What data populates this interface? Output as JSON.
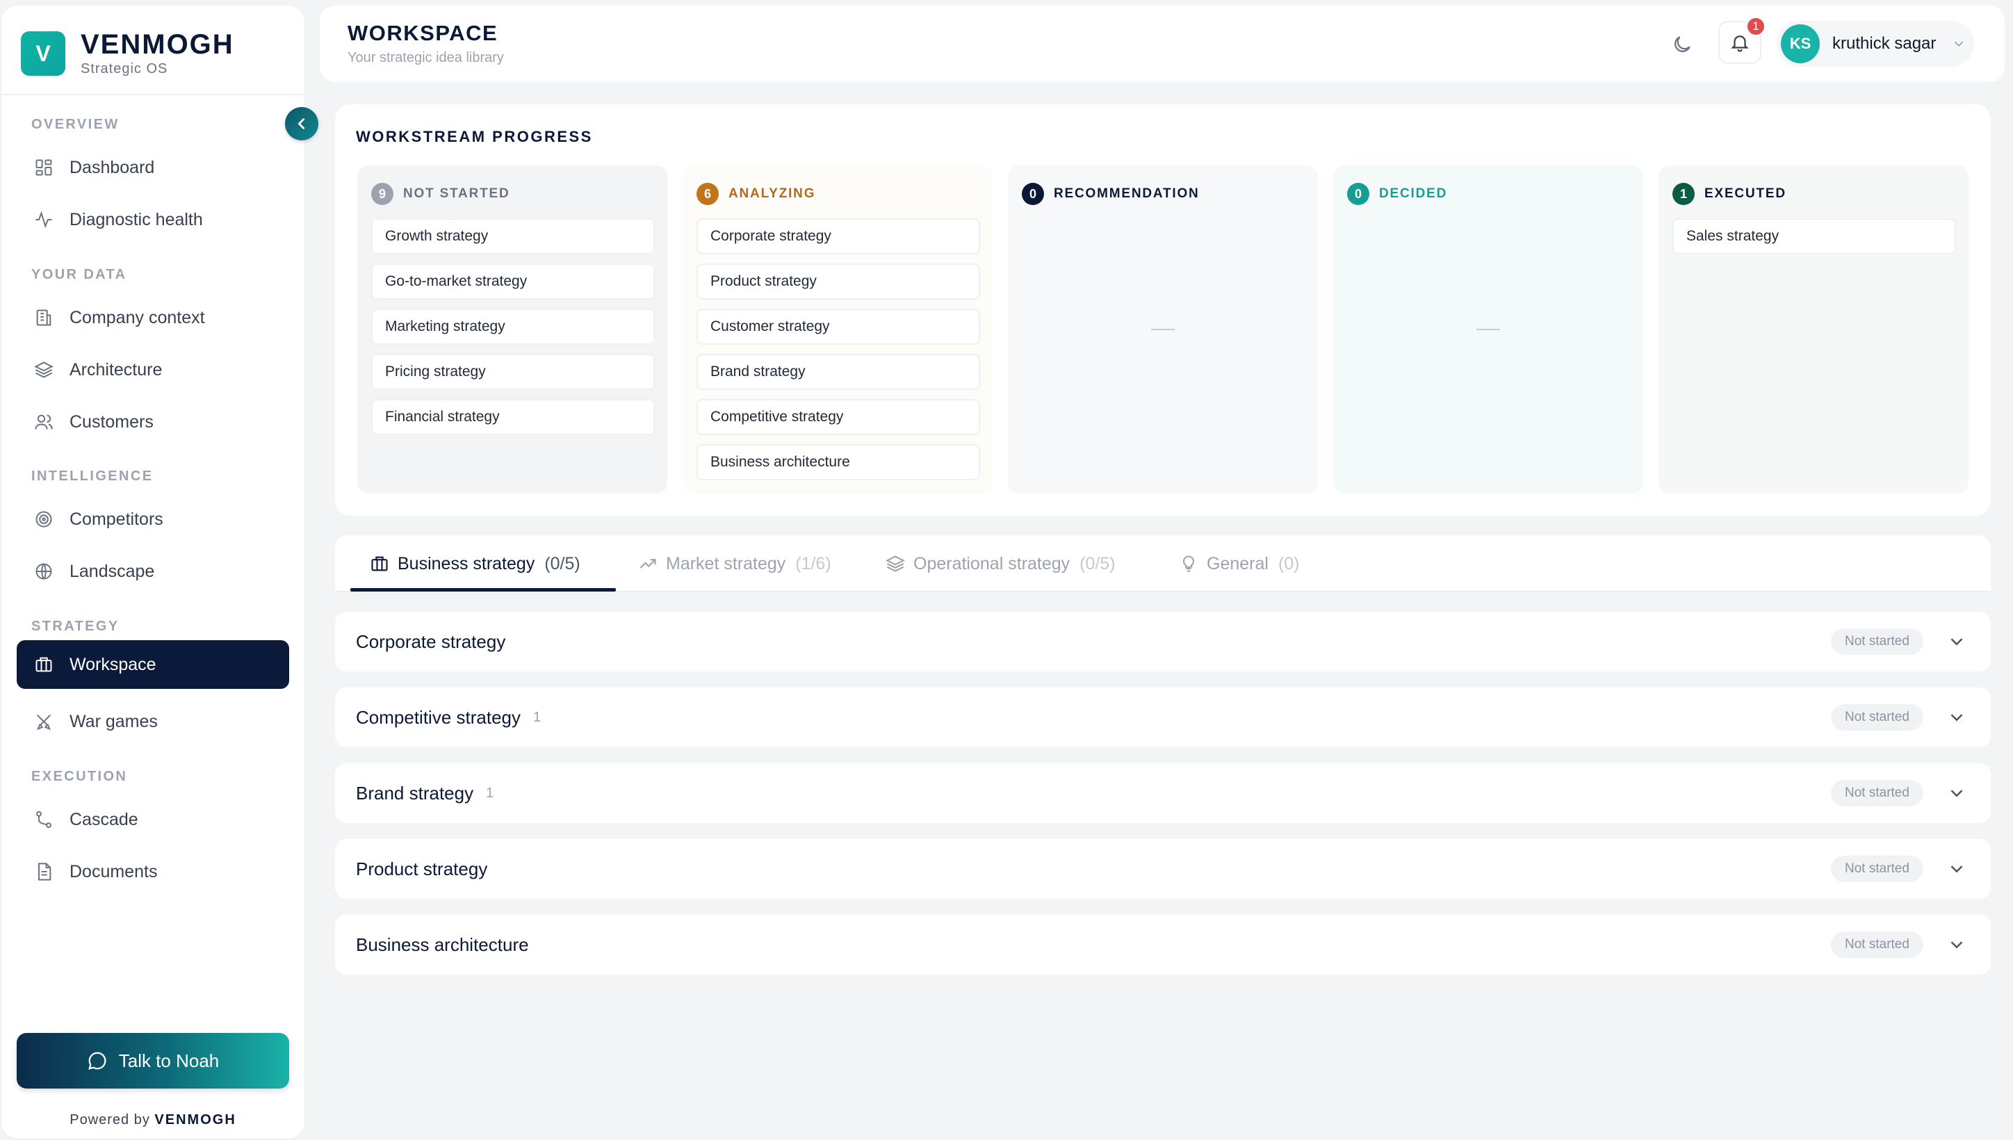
{
  "brand": {
    "logo_letter": "V",
    "name": "VENMOGH",
    "subtitle": "Strategic OS"
  },
  "sidebar": {
    "sections": [
      {
        "label": "OVERVIEW",
        "items": [
          {
            "label": "Dashboard",
            "icon": "dashboard-icon"
          },
          {
            "label": "Diagnostic health",
            "icon": "pulse-icon"
          }
        ]
      },
      {
        "label": "YOUR DATA",
        "items": [
          {
            "label": "Company context",
            "icon": "building-icon"
          },
          {
            "label": "Architecture",
            "icon": "layers-icon"
          },
          {
            "label": "Customers",
            "icon": "users-icon"
          }
        ]
      },
      {
        "label": "INTELLIGENCE",
        "items": [
          {
            "label": "Competitors",
            "icon": "target-icon"
          },
          {
            "label": "Landscape",
            "icon": "globe-icon"
          }
        ]
      },
      {
        "label": "STRATEGY",
        "items": [
          {
            "label": "Workspace",
            "icon": "briefcase-icon",
            "active": true
          },
          {
            "label": "War games",
            "icon": "swords-icon"
          }
        ]
      },
      {
        "label": "EXECUTION",
        "items": [
          {
            "label": "Cascade",
            "icon": "branch-icon"
          },
          {
            "label": "Documents",
            "icon": "document-icon"
          }
        ]
      }
    ],
    "talk_button": "Talk to Noah",
    "powered_prefix": "Powered by",
    "powered_brand": "VENMOGH"
  },
  "header": {
    "title": "WORKSPACE",
    "subtitle": "Your strategic idea library",
    "notification_count": "1",
    "user": {
      "initials": "KS",
      "name": "kruthick sagar"
    }
  },
  "workstream": {
    "title": "WORKSTREAM PROGRESS",
    "columns": [
      {
        "label": "NOT STARTED",
        "count": "9",
        "color": "#9ca3af",
        "label_color": "#6b7280",
        "bg": "#f3f4f6",
        "items": [
          "Growth strategy",
          "Go-to-market strategy",
          "Marketing strategy",
          "Pricing strategy",
          "Financial strategy"
        ]
      },
      {
        "label": "ANALYZING",
        "count": "6",
        "color": "#c2741c",
        "label_color": "#b4681a",
        "bg": "#fdfcf8",
        "items": [
          "Corporate strategy",
          "Product strategy",
          "Customer strategy",
          "Brand strategy",
          "Competitive strategy",
          "Business architecture"
        ]
      },
      {
        "label": "RECOMMENDATION",
        "count": "0",
        "color": "#0b1836",
        "label_color": "#0b1836",
        "bg": "#f7f8fa",
        "items": []
      },
      {
        "label": "DECIDED",
        "count": "0",
        "color": "#169e93",
        "label_color": "#169e93",
        "bg": "#f4f9fa",
        "items": []
      },
      {
        "label": "EXECUTED",
        "count": "1",
        "color": "#0c5c45",
        "label_color": "#0b1836",
        "bg": "#f5f8f7",
        "items": [
          "Sales strategy"
        ]
      }
    ]
  },
  "tabs": [
    {
      "label": "Business strategy",
      "count": "(0/5)",
      "icon": "briefcase-icon",
      "active": true
    },
    {
      "label": "Market strategy",
      "count": "(1/6)",
      "icon": "trend-up-icon"
    },
    {
      "label": "Operational strategy",
      "count": "(0/5)",
      "icon": "layers-icon"
    },
    {
      "label": "General",
      "count": "(0)",
      "icon": "lightbulb-icon"
    }
  ],
  "rows": [
    {
      "title": "Corporate strategy",
      "count": "",
      "status": "Not started"
    },
    {
      "title": "Competitive strategy",
      "count": "1",
      "status": "Not started"
    },
    {
      "title": "Brand strategy",
      "count": "1",
      "status": "Not started"
    },
    {
      "title": "Product strategy",
      "count": "",
      "status": "Not started"
    },
    {
      "title": "Business architecture",
      "count": "",
      "status": "Not started"
    }
  ]
}
